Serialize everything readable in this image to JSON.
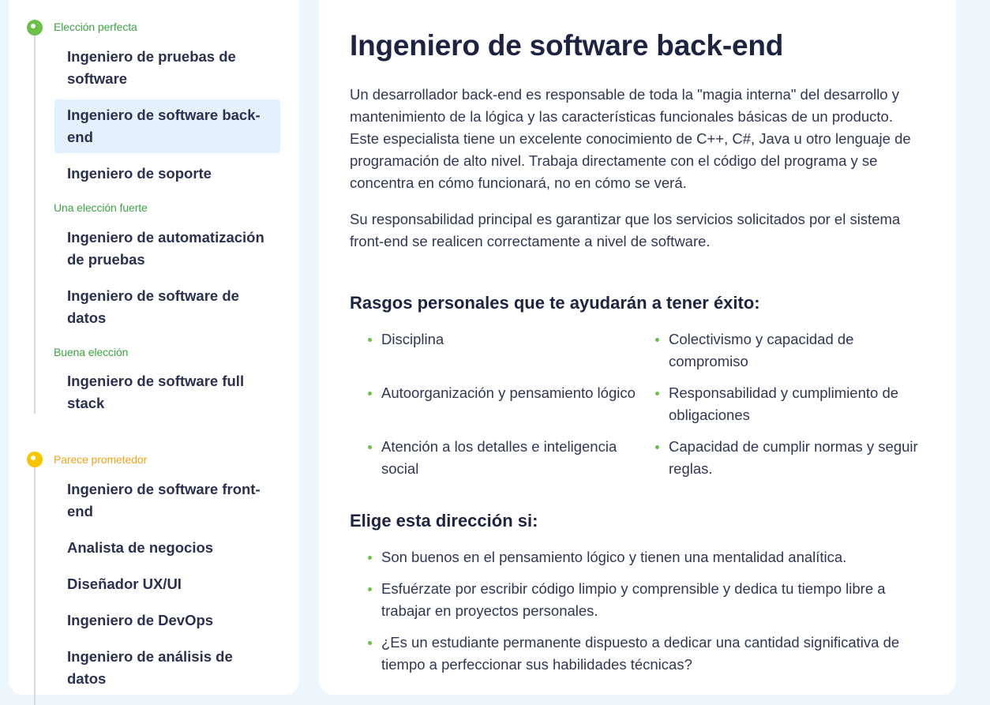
{
  "sidebar": {
    "groups": [
      {
        "tier": "Elección perfecta",
        "items": [
          {
            "label": "Ingeniero de pruebas de software"
          },
          {
            "label": "Ingeniero de software back-end"
          },
          {
            "label": "Ingeniero de soporte"
          }
        ]
      },
      {
        "tier": "Una elección fuerte",
        "items": [
          {
            "label": "Ingeniero de automatización de pruebas"
          },
          {
            "label": "Ingeniero de software de datos"
          }
        ]
      },
      {
        "tier": "Buena elección",
        "items": [
          {
            "label": "Ingeniero de software full stack"
          }
        ]
      },
      {
        "tier": "Parece prometedor",
        "items": [
          {
            "label": "Ingeniero de software front-end"
          },
          {
            "label": "Analista de negocios"
          },
          {
            "label": "Diseñador UX/UI"
          },
          {
            "label": "Ingeniero de DevOps"
          },
          {
            "label": "Ingeniero de análisis de datos"
          }
        ]
      }
    ],
    "active_item": "Ingeniero de software back-end"
  },
  "main": {
    "title": "Ingeniero de software back-end",
    "paragraphs": [
      "Un desarrollador back-end es responsable de toda la \"magia interna\" del desarrollo y mantenimiento de la lógica y las características funcionales básicas de un producto. Este especialista tiene un excelente conocimiento de C++, C#, Java u otro lenguaje de programación de alto nivel. Trabaja directamente con el código del programa y se concentra en cómo funcionará, no en cómo se verá.",
      "Su responsabilidad principal es garantizar que los servicios solicitados por el sistema front-end se realicen correctamente a nivel de software."
    ],
    "traits_heading": "Rasgos personales que te ayudarán a tener éxito:",
    "traits": [
      "Disciplina",
      "Colectivismo y capacidad de compromiso",
      "Autoorganización y pensamiento lógico",
      "Responsabilidad y cumplimiento de obligaciones",
      "Atención a los detalles e inteligencia social",
      "Capacidad de cumplir normas y seguir reglas."
    ],
    "direction_heading": "Elige esta dirección si:",
    "direction": [
      "Son buenos en el pensamiento lógico y tienen una mentalidad analítica.",
      "Esfuérzate por escribir código limpio y comprensible y dedica tu tiempo libre a trabajar en proyectos personales.",
      "¿Es un estudiante permanente dispuesto a dedicar una cantidad significativa de tiempo a perfeccionar sus habilidades técnicas?"
    ]
  },
  "colors": {
    "accent_green": "#6cc04a",
    "accent_yellow": "#f7c600",
    "active_bg": "#e3f1fc",
    "page_bg": "#eef6fd"
  }
}
